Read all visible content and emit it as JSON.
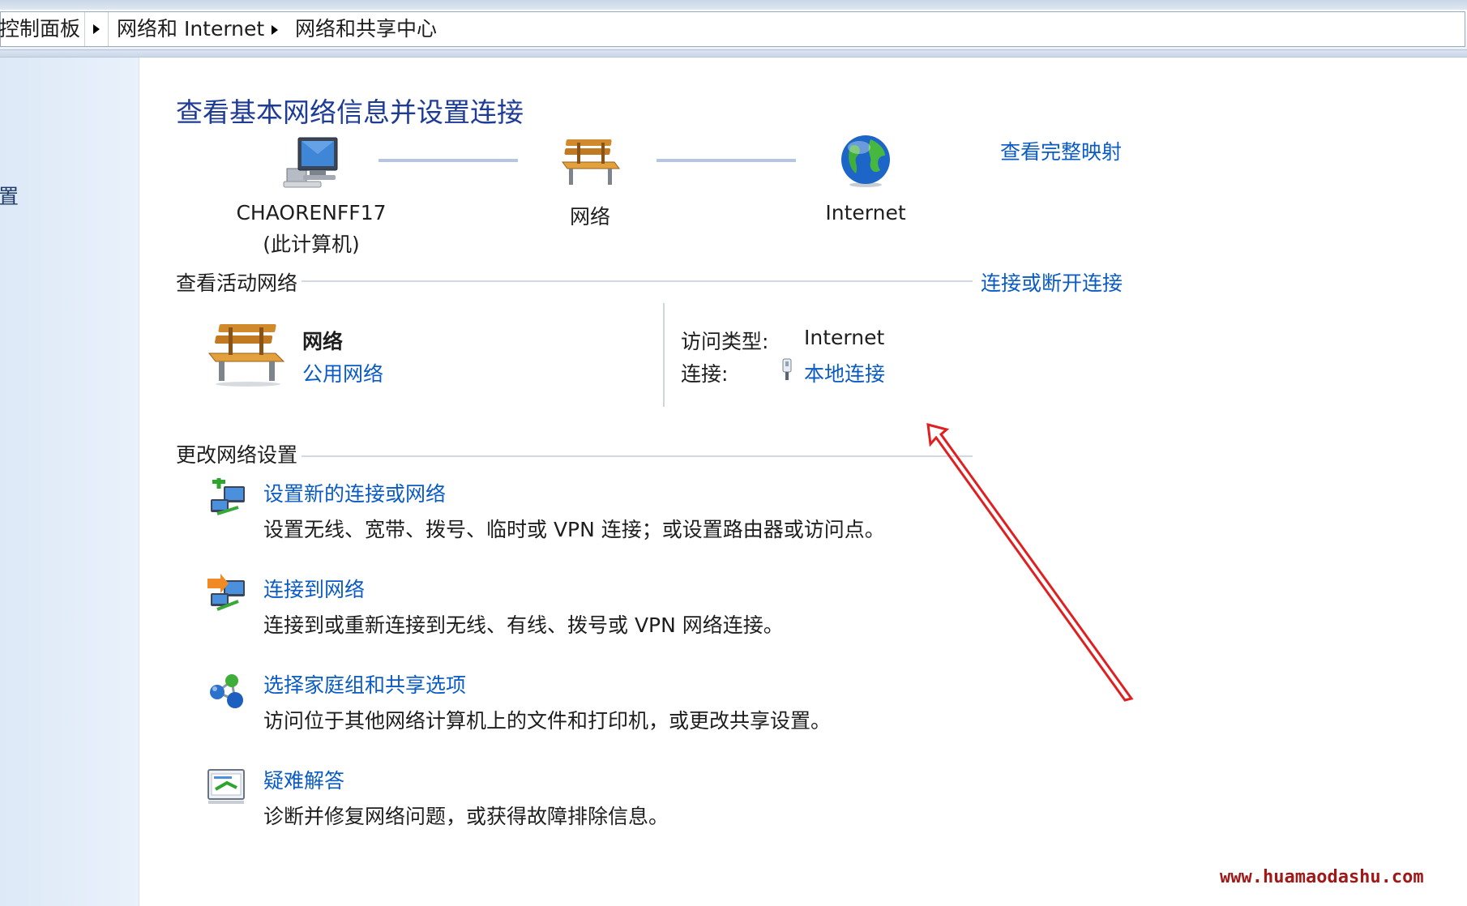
{
  "breadcrumb": {
    "items": [
      "控制面板",
      "网络和 Internet",
      "网络和共享中心"
    ]
  },
  "left_pane": {
    "fragment": "置"
  },
  "main": {
    "title": "查看基本网络信息并设置连接",
    "map_link": "查看完整映射",
    "map_nodes": {
      "computer": {
        "name": "CHAORENFF17",
        "sub": "(此计算机)"
      },
      "network": {
        "name": "网络"
      },
      "internet": {
        "name": "Internet"
      }
    },
    "active_section": {
      "heading": "查看活动网络",
      "link": "连接或断开连接",
      "network_name": "网络",
      "network_type": "公用网络",
      "access_type_label": "访问类型:",
      "access_type_value": "Internet",
      "connection_label": "连接:",
      "connection_value": "本地连接"
    },
    "change_section": {
      "heading": "更改网络设置",
      "tasks": [
        {
          "title": "设置新的连接或网络",
          "desc": "设置无线、宽带、拨号、临时或 VPN 连接；或设置路由器或访问点。",
          "icon": "new-connection-icon"
        },
        {
          "title": "连接到网络",
          "desc": "连接到或重新连接到无线、有线、拨号或 VPN 网络连接。",
          "icon": "connect-network-icon"
        },
        {
          "title": "选择家庭组和共享选项",
          "desc": "访问位于其他网络计算机上的文件和打印机，或更改共享设置。",
          "icon": "homegroup-icon"
        },
        {
          "title": "疑难解答",
          "desc": "诊断并修复网络问题，或获得故障排除信息。",
          "icon": "troubleshoot-icon"
        }
      ]
    }
  },
  "watermark": "www.huamaodashu.com",
  "colors": {
    "title": "#1e3c96",
    "link": "#0a5bc4",
    "annotation_arrow": "#e02020",
    "watermark": "#a01818"
  }
}
